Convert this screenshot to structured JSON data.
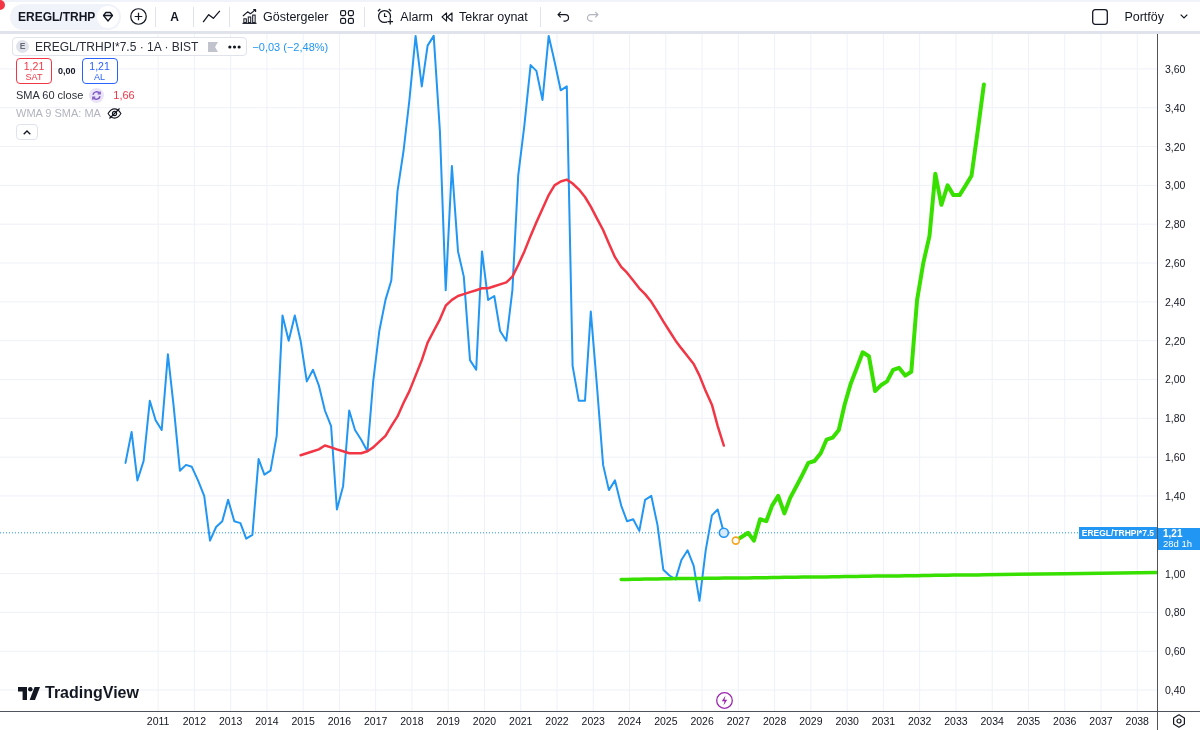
{
  "toolbar": {
    "symbol": "EREGL/TRHP",
    "interval": "A",
    "buttons": [
      {
        "kind": "indicators",
        "label": "Göstergeler"
      },
      {
        "kind": "alert",
        "label": "Alarm"
      },
      {
        "kind": "replay",
        "label": "Tekrar oynat"
      }
    ],
    "history": [
      {
        "kind": "undo",
        "disabled": false
      },
      {
        "kind": "redo",
        "disabled": true
      }
    ],
    "layout_name": "Portföy"
  },
  "legend": {
    "logo": "E",
    "title": "EREGL/TRHPI*7.5 · 1A · BIST",
    "change": "−0,03 (−2,48%)",
    "sell": {
      "price": "1,21",
      "label": "SAT"
    },
    "spread": "0,00",
    "buy": {
      "price": "1,21",
      "label": "AL"
    },
    "indicators": [
      {
        "name": "SMA 60 close",
        "value": "1,66",
        "visible": true
      },
      {
        "name": "WMA 9 SMA: MA",
        "visible": false
      }
    ]
  },
  "chart": {
    "chart_data": {
      "type": "line",
      "grid": true,
      "x": [
        2010.1,
        2010.27,
        2010.43,
        2010.6,
        2010.77,
        2010.93,
        2011.1,
        2011.27,
        2011.43,
        2011.6,
        2011.77,
        2011.93,
        2012.1,
        2012.27,
        2012.43,
        2012.6,
        2012.77,
        2012.93,
        2013.1,
        2013.27,
        2013.43,
        2013.6,
        2013.77,
        2013.93,
        2014.1,
        2014.27,
        2014.43,
        2014.6,
        2014.77,
        2014.93,
        2015.1,
        2015.27,
        2015.43,
        2015.6,
        2015.77,
        2015.93,
        2016.1,
        2016.27,
        2016.43,
        2016.6,
        2016.77,
        2016.93,
        2017.1,
        2017.27,
        2017.43,
        2017.6,
        2017.77,
        2017.93,
        2018.1,
        2018.27,
        2018.43,
        2018.6,
        2018.77,
        2018.93,
        2019.1,
        2019.27,
        2019.43,
        2019.6,
        2019.77,
        2019.93,
        2020.1,
        2020.27,
        2020.43,
        2020.6,
        2020.77,
        2020.93,
        2021.1,
        2021.27,
        2021.43,
        2021.6,
        2021.77,
        2021.93,
        2022.1,
        2022.27,
        2022.43,
        2022.6,
        2022.77,
        2022.93,
        2023.1,
        2023.27,
        2023.43,
        2023.6,
        2023.77,
        2023.93,
        2024.1,
        2024.27,
        2024.43,
        2024.6,
        2024.77,
        2024.93,
        2025.1,
        2025.27,
        2025.43,
        2025.6,
        2025.77,
        2025.93,
        2026.1,
        2026.27,
        2026.43,
        2026.6,
        2026.77,
        2026.93,
        2027.1,
        2027.27,
        2027.43,
        2027.6,
        2027.77,
        2027.93,
        2028.1,
        2028.27,
        2028.43,
        2028.6,
        2028.77,
        2028.93,
        2029.1,
        2029.27,
        2029.43,
        2029.6,
        2029.77,
        2029.93,
        2030.1,
        2030.27,
        2030.43,
        2030.6,
        2030.77,
        2030.93,
        2031.1,
        2031.27,
        2031.43,
        2031.6,
        2031.77,
        2031.93,
        2032.1,
        2032.27,
        2032.43,
        2032.6,
        2032.77,
        2032.93,
        2033.1,
        2033.27,
        2033.43,
        2033.6,
        2033.77,
        2036.0,
        2038.55
      ],
      "series": [
        {
          "name": "EREGL/TRHPI*7.5",
          "color": "#2196f3",
          "values": [
            1.57,
            1.73,
            1.48,
            1.58,
            1.89,
            1.79,
            1.74,
            2.13,
            1.86,
            1.53,
            1.56,
            1.55,
            1.48,
            1.4,
            1.17,
            1.24,
            1.27,
            1.38,
            1.27,
            1.26,
            1.18,
            1.2,
            1.59,
            1.51,
            1.53,
            1.71,
            2.33,
            2.2,
            2.33,
            2.2,
            1.99,
            2.05,
            1.97,
            1.84,
            1.76,
            1.33,
            1.45,
            1.84,
            1.74,
            1.69,
            1.63,
            1.99,
            2.25,
            2.41,
            2.51,
            2.97,
            3.18,
            3.44,
            3.77,
            3.51,
            3.72,
            3.77,
            3.28,
            2.46,
            3.1,
            2.66,
            2.53,
            2.1,
            2.05,
            2.66,
            2.41,
            2.43,
            2.25,
            2.2,
            2.46,
            3.05,
            3.31,
            3.62,
            3.59,
            3.44,
            3.77,
            3.64,
            3.49,
            3.51,
            2.07,
            1.89,
            1.89,
            2.35,
            1.97,
            1.56,
            1.43,
            1.48,
            1.35,
            1.27,
            1.28,
            1.22,
            1.38,
            1.4,
            1.25,
            1.02,
            0.99,
            0.97,
            1.07,
            1.12,
            1.04,
            0.86,
            1.12,
            1.3,
            1.33,
            1.21,
            null,
            null,
            null,
            null,
            null,
            null,
            null,
            null,
            null,
            null,
            null,
            null,
            null,
            null,
            null,
            null,
            null,
            null,
            null,
            null,
            null,
            null,
            null,
            null,
            null,
            null,
            null,
            null,
            null,
            null,
            null,
            null,
            null,
            null,
            null,
            null,
            null,
            null,
            null,
            null,
            null,
            null,
            null,
            null,
            null
          ]
        },
        {
          "color": "#f23645",
          "values": [
            null,
            null,
            null,
            null,
            null,
            null,
            null,
            null,
            null,
            null,
            null,
            null,
            null,
            null,
            null,
            null,
            null,
            null,
            null,
            null,
            null,
            null,
            null,
            null,
            null,
            null,
            null,
            null,
            null,
            1.61,
            1.62,
            1.63,
            1.64,
            1.66,
            1.65,
            1.64,
            1.63,
            1.62,
            1.62,
            1.62,
            1.63,
            1.65,
            1.68,
            1.71,
            1.76,
            1.81,
            1.88,
            1.94,
            2.02,
            2.1,
            2.19,
            2.25,
            2.31,
            2.38,
            2.41,
            2.43,
            2.44,
            2.45,
            2.46,
            2.47,
            2.47,
            2.48,
            2.49,
            2.5,
            2.53,
            2.59,
            2.66,
            2.74,
            2.81,
            2.88,
            2.95,
            3.0,
            3.02,
            3.03,
            3.01,
            2.98,
            2.94,
            2.89,
            2.83,
            2.77,
            2.7,
            2.63,
            2.58,
            2.55,
            2.51,
            2.47,
            2.44,
            2.4,
            2.35,
            2.3,
            2.25,
            2.2,
            2.16,
            2.12,
            2.08,
            2.02,
            1.94,
            1.87,
            1.76,
            1.66,
            null,
            null,
            null,
            null,
            null,
            null,
            null,
            null,
            null,
            null,
            null,
            null,
            null,
            null,
            null,
            null,
            null,
            null,
            null,
            null,
            null,
            null,
            null,
            null,
            null,
            null,
            null,
            null,
            null,
            null,
            null,
            null,
            null,
            null,
            null,
            null,
            null,
            null,
            null,
            null,
            null,
            null,
            null,
            null,
            null
          ]
        },
        {
          "color": "#38e000",
          "values": [
            null,
            null,
            null,
            null,
            null,
            null,
            null,
            null,
            null,
            null,
            null,
            null,
            null,
            null,
            null,
            null,
            null,
            null,
            null,
            null,
            null,
            null,
            null,
            null,
            null,
            null,
            null,
            null,
            null,
            null,
            null,
            null,
            null,
            null,
            null,
            null,
            null,
            null,
            null,
            null,
            null,
            null,
            null,
            null,
            null,
            null,
            null,
            null,
            null,
            null,
            null,
            null,
            null,
            null,
            null,
            null,
            null,
            null,
            null,
            null,
            null,
            null,
            null,
            null,
            null,
            null,
            null,
            null,
            null,
            null,
            null,
            null,
            null,
            null,
            null,
            null,
            null,
            null,
            null,
            null,
            null,
            null,
            null,
            null,
            null,
            null,
            null,
            null,
            null,
            null,
            null,
            null,
            null,
            null,
            null,
            null,
            null,
            null,
            null,
            null,
            null,
            1.17,
            1.19,
            1.21,
            1.17,
            1.28,
            1.27,
            1.35,
            1.4,
            1.31,
            1.39,
            1.45,
            1.51,
            1.57,
            1.58,
            1.62,
            1.69,
            1.7,
            1.74,
            1.87,
            1.98,
            2.06,
            2.14,
            2.12,
            1.94,
            1.97,
            1.99,
            2.05,
            2.06,
            2.02,
            2.04,
            2.41,
            2.6,
            2.74,
            3.06,
            2.9,
            3.0,
            2.95,
            2.95,
            3.0,
            3.05,
            3.28,
            3.52,
            null,
            null
          ]
        },
        {
          "color": "#38e000",
          "values": [
            null,
            null,
            null,
            null,
            null,
            null,
            null,
            null,
            null,
            null,
            null,
            null,
            null,
            null,
            null,
            null,
            null,
            null,
            null,
            null,
            null,
            null,
            null,
            null,
            null,
            null,
            null,
            null,
            null,
            null,
            null,
            null,
            null,
            null,
            null,
            null,
            null,
            null,
            null,
            null,
            null,
            null,
            null,
            null,
            null,
            null,
            null,
            null,
            null,
            null,
            null,
            null,
            null,
            null,
            null,
            null,
            null,
            null,
            null,
            null,
            null,
            null,
            null,
            null,
            null,
            null,
            null,
            null,
            null,
            null,
            null,
            null,
            null,
            null,
            null,
            null,
            null,
            null,
            null,
            null,
            null,
            null,
            0.97,
            0.97,
            0.971,
            0.971,
            0.972,
            0.972,
            0.972,
            0.973,
            0.973,
            0.974,
            0.974,
            0.974,
            0.975,
            0.975,
            0.976,
            0.976,
            0.976,
            0.977,
            0.977,
            0.978,
            0.978,
            0.978,
            0.979,
            0.979,
            0.979,
            0.98,
            0.98,
            0.981,
            0.981,
            0.981,
            0.982,
            0.982,
            0.983,
            0.983,
            0.983,
            0.984,
            0.984,
            0.985,
            0.985,
            0.985,
            0.986,
            0.986,
            0.987,
            0.987,
            0.987,
            0.988,
            0.988,
            0.989,
            0.989,
            0.989,
            0.99,
            0.99,
            0.991,
            0.991,
            0.991,
            0.992,
            0.992,
            0.993,
            0.993,
            0.993,
            0.994,
            0.999,
            1.005
          ]
        }
      ],
      "ref_lines": [
        {
          "axis": "y",
          "value": 1.21
        }
      ],
      "xlim": [
        2006.64,
        2039.73
      ],
      "ylim": [
        0.292,
        3.78
      ],
      "xticks": [
        2011,
        2012,
        2013,
        2014,
        2015,
        2016,
        2017,
        2018,
        2019,
        2020,
        2021,
        2022,
        2023,
        2024,
        2025,
        2026,
        2027,
        2028,
        2029,
        2030,
        2031,
        2032,
        2033,
        2034,
        2035,
        2036,
        2037,
        2038
      ],
      "yticks": [
        {
          "value": 0.4,
          "label": "0,40"
        },
        {
          "value": 0.6,
          "label": "0,60"
        },
        {
          "value": 0.8,
          "label": "0,80"
        },
        {
          "value": 1.0,
          "label": "1,00"
        },
        {
          "value": 1.4,
          "label": "1,40"
        },
        {
          "value": 1.6,
          "label": "1,60"
        },
        {
          "value": 1.8,
          "label": "1,80"
        },
        {
          "value": 2.0,
          "label": "2,00"
        },
        {
          "value": 2.2,
          "label": "2,20"
        },
        {
          "value": 2.4,
          "label": "2,40"
        },
        {
          "value": 2.6,
          "label": "2,60"
        },
        {
          "value": 2.8,
          "label": "2,80"
        },
        {
          "value": 3.0,
          "label": "3,00"
        },
        {
          "value": 3.2,
          "label": "3,20"
        },
        {
          "value": 3.4,
          "label": "3,40"
        },
        {
          "value": 3.6,
          "label": "3,60"
        }
      ]
    },
    "price_tag": {
      "price": "1,21",
      "countdown": "28d 1h"
    }
  },
  "branding": {
    "name": "TradingView"
  }
}
